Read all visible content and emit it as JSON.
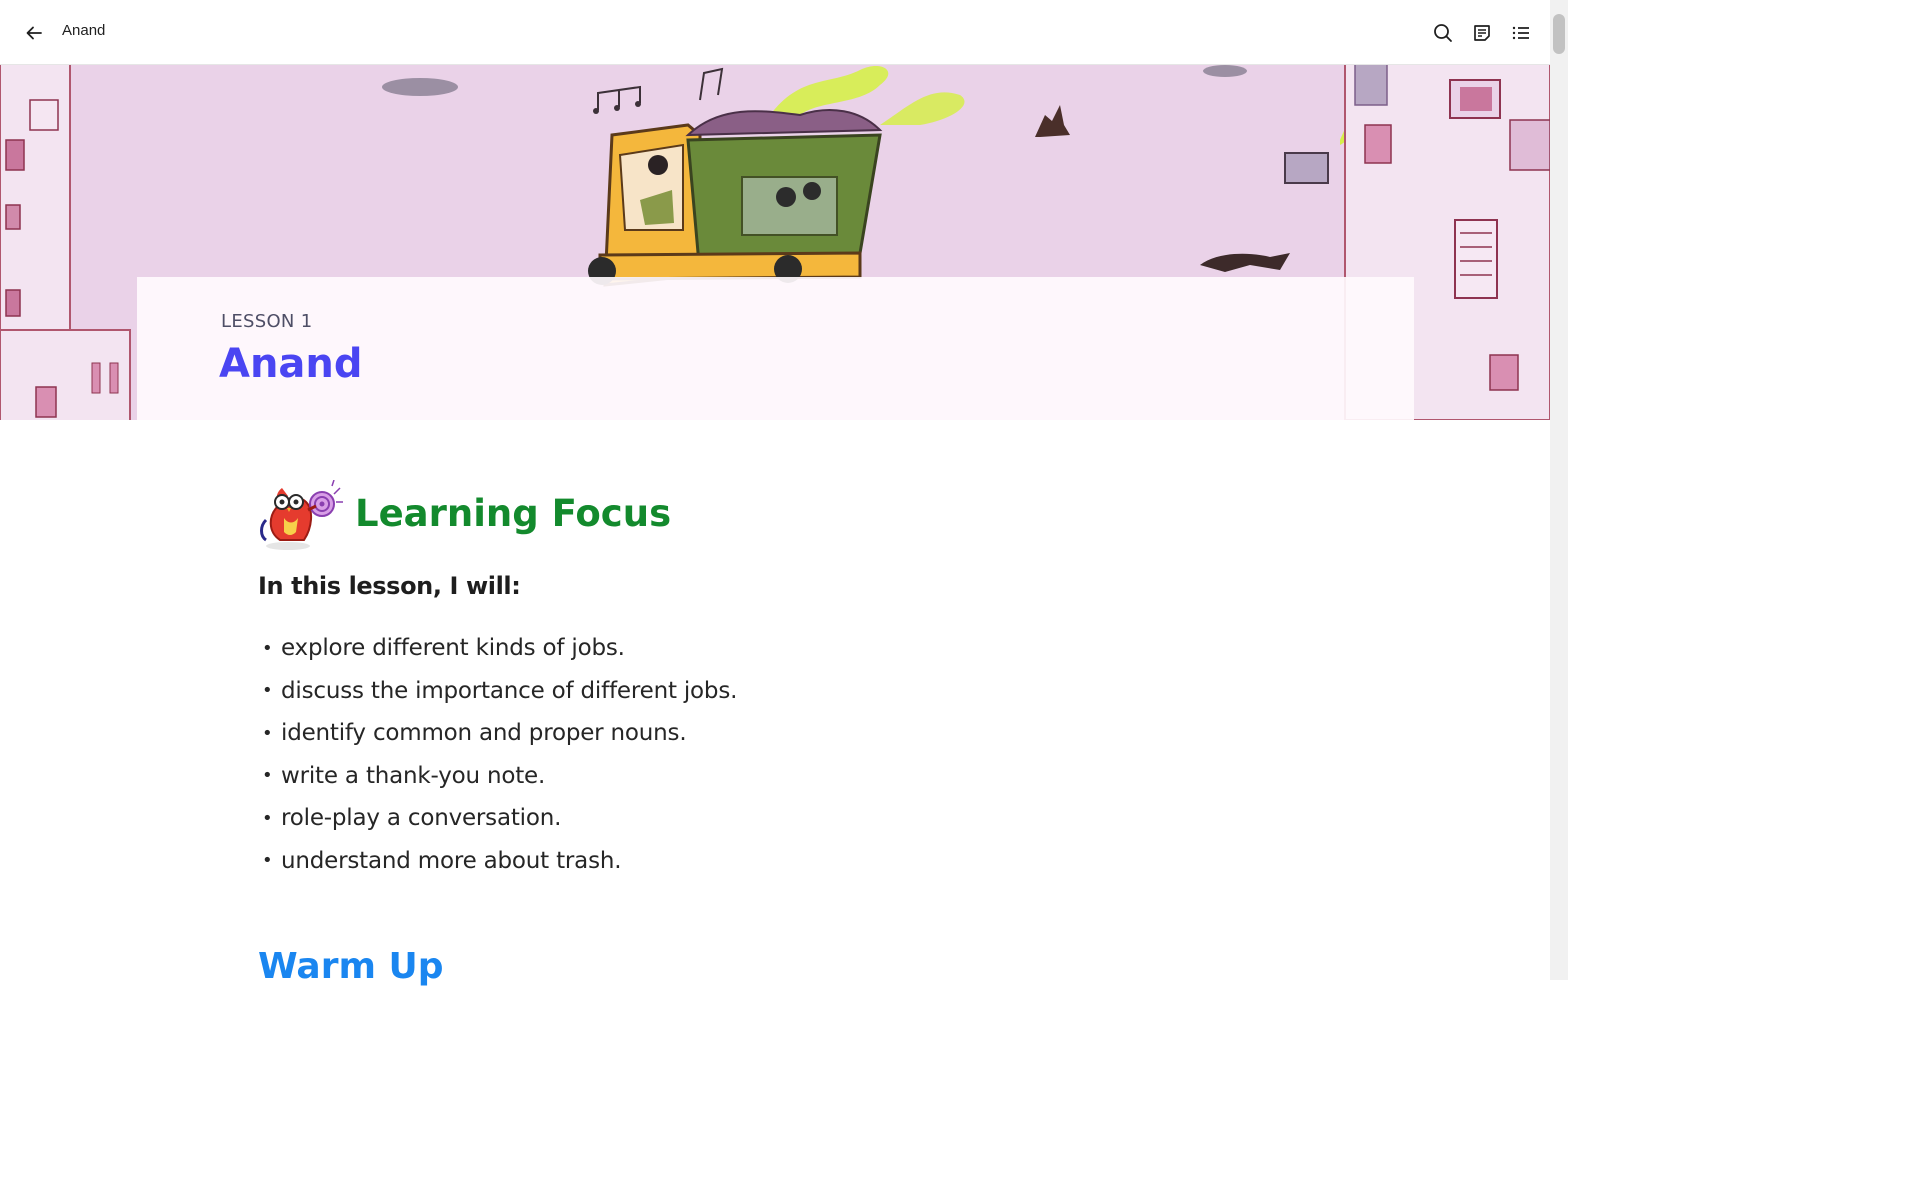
{
  "topbar": {
    "title": "Anand",
    "icons": [
      "back-arrow-icon",
      "search-icon",
      "notes-icon",
      "contents-list-icon"
    ]
  },
  "hero": {
    "lesson_label": "LESSON 1",
    "lesson_title": "Anand",
    "background_color": "#ead2e8"
  },
  "learning_focus": {
    "title": "Learning Focus",
    "intro": "In this lesson, I will:",
    "bullet": "•",
    "items": [
      "explore different kinds of jobs.",
      "discuss the importance of different jobs.",
      "identify common and proper nouns.",
      "write a thank-you note.",
      "role-play a conversation.",
      "understand more about trash."
    ]
  },
  "next_section": {
    "title": "Warm Up"
  },
  "colors": {
    "lesson_title": "#4a45f2",
    "focus_title": "#138a2d",
    "warm_up": "#1a86f0"
  }
}
